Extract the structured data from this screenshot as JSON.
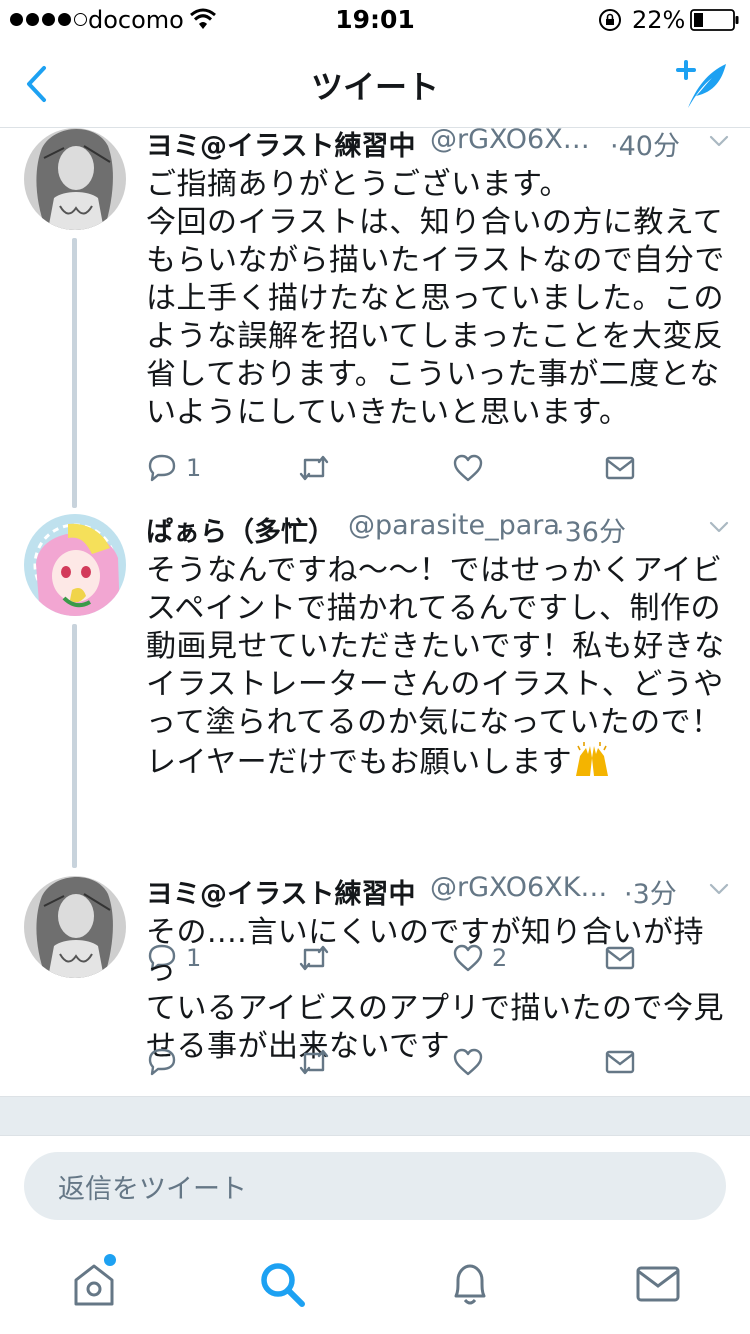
{
  "status_bar": {
    "carrier": "docomo",
    "time": "19:01",
    "battery": "22%"
  },
  "nav": {
    "title": "ツイート"
  },
  "tweets": [
    {
      "name": "ヨミ@イラスト練習中",
      "handle": "@rGXO6X…",
      "time": "·40分",
      "body": "ご指摘ありがとうございます。\n今回のイラストは、知り合いの方に教えて\nもらいながら描いたイラストなので自分で\nは上手く描けたなと思っていました。この\nような誤解を招いてしまったことを大変反\n省しております。こういった事が二度とな\nいようにしていきたいと思います。",
      "replies": "1",
      "retweets": "",
      "likes": ""
    },
    {
      "name": "ぱぁら（多忙）",
      "handle": "@parasite_para",
      "time": "·36分",
      "body": "そうなんですね〜〜！ではせっかくアイビ\nスペイントで描かれてるんですし、制作の\n動画見せていただきたいです！私も好きな\nイラストレーターさんのイラスト、どうや\nって塗られてるのか気になっていたので！\nレイヤーだけでもお願いします",
      "emoji": "🙌",
      "replies": "1",
      "retweets": "",
      "likes": "2"
    },
    {
      "name": "ヨミ@イラスト練習中",
      "handle": "@rGXO6XK…",
      "time": "·3分",
      "body": "その....言いにくいのですが知り合いが持っ\nているアイビスのアプリで描いたので今見\nせる事が出来ないです",
      "replies": "",
      "retweets": "",
      "likes": ""
    }
  ],
  "reply": {
    "placeholder": "返信をツイート"
  },
  "tabs": [
    "home-icon",
    "search-icon",
    "bell-icon",
    "mail-icon"
  ],
  "colors": {
    "accent": "#1da1f2",
    "muted": "#657786",
    "text": "#14171a",
    "thread_line": "#c8d3dc",
    "band": "#e6ecf0"
  }
}
